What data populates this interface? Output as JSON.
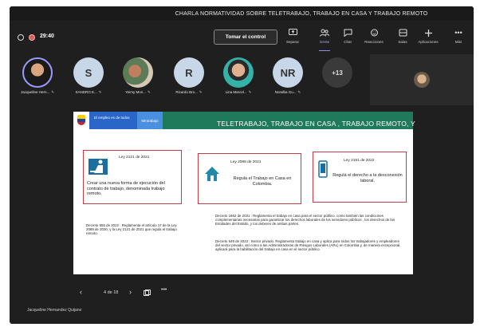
{
  "window": {
    "title": "CHARLA NORMATIVIDAD SOBRE TELETRABAJO, TRABAJO EN CASA Y TRABAJO REMOTO"
  },
  "toolbar": {
    "timer": "29:40",
    "take_control": "Tomar el control",
    "tools": [
      {
        "label": "Separar",
        "icon": "share-screen-icon"
      },
      {
        "label": "Gente",
        "icon": "people-icon"
      },
      {
        "label": "Chat",
        "icon": "chat-icon"
      },
      {
        "label": "Reacciones",
        "icon": "reactions-icon"
      },
      {
        "label": "Salas",
        "icon": "rooms-icon"
      },
      {
        "label": "Aplicaciones",
        "icon": "apps-icon"
      },
      {
        "label": "Más",
        "icon": "more-icon"
      }
    ]
  },
  "participants": [
    {
      "name": "Jacqueline Hern...",
      "initials": ""
    },
    {
      "name": "SANDRO E...",
      "initials": "S"
    },
    {
      "name": "Yeimy Mon...",
      "initials": ""
    },
    {
      "name": "Ricardo Bro...",
      "initials": "R"
    },
    {
      "name": "Lina Marcel...",
      "initials": ""
    },
    {
      "name": "Noralba Gu...",
      "initials": "NR"
    }
  ],
  "overflow_count": "+13",
  "slide": {
    "logo_text": "El empleo es de todos",
    "ministry_label": "Mintrabajo",
    "title": "TELETRABAJO, TRABAJO EN CASA , TRABAJO REMOTO, Y",
    "box1": {
      "title": "Ley 2121 de 2021",
      "body": "Crear una nueva forma de ejecución del contrato de trabajo, denominada trabajo remoto."
    },
    "box2": {
      "title": "Ley 2088 de 2021",
      "body": "Regula el Trabajo en Casa en Colombia."
    },
    "box3": {
      "title": "Ley 2191 de 2022",
      "body": "Regulá el derecho a la desconexión laboral."
    },
    "decree_left": "Decreto 555 de 2022 : Reglamenta el artículo 17 de la Ley 2088 de 2020, y la Ley 2121 de 2021 que regula el trabajo remoto.",
    "decree_right_1": "Decreto 1662 de 2021 : Reglamenta el trabajo en casa para el sector público, como también las condiciones complementarias necesarias para garantizar los derechos laborales de los servidores públicos , los derechos de las Entidades del Estado, y los deberes de ambas partes.",
    "decree_right_2": "Decreto 649 de 2022 : Sector privado. Reglamenta trabajo en casa y aplica para todos los trabajadores y empleadores del sector privado, así como a las Administradoras de Riesgos Laborales (ARL) en Colombia y, de manera excepcional, aplicará para la habilitación del trabajo en casa en el sector público."
  },
  "navigation": {
    "page_indicator": "4 de 18"
  },
  "presenter": "Jacqueline Hernandez Quijano"
}
